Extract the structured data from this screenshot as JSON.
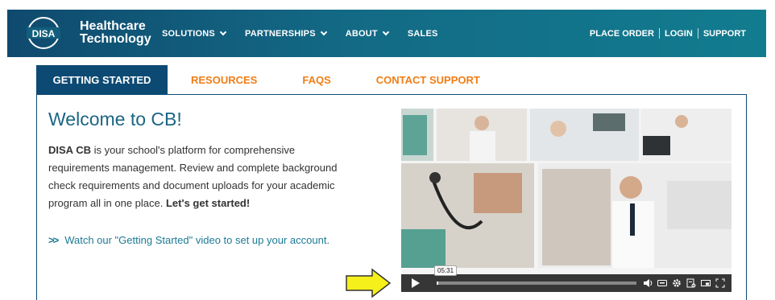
{
  "brand": {
    "logo": "DISA",
    "line1": "Healthcare",
    "line2": "Technology"
  },
  "nav": [
    {
      "label": "SOLUTIONS",
      "dropdown": true
    },
    {
      "label": "PARTNERSHIPS",
      "dropdown": true
    },
    {
      "label": "ABOUT",
      "dropdown": true
    },
    {
      "label": "SALES",
      "dropdown": false
    }
  ],
  "util_nav": [
    "PLACE ORDER",
    "LOGIN",
    "SUPPORT"
  ],
  "tabs": [
    "GETTING STARTED",
    "RESOURCES",
    "FAQS",
    "CONTACT SUPPORT"
  ],
  "content": {
    "title": "Welcome to CB!",
    "desc_brand": "DISA CB",
    "desc_body": " is your school's platform for comprehensive requirements management. Review and complete background check requirements and document uploads for your academic program all in one place. ",
    "desc_cta": "Let's get started!",
    "watch_arrows": ">>",
    "watch_text": "Watch our \"Getting Started\" video to set up your account."
  },
  "video": {
    "time": "05:31",
    "progress": 0.01
  },
  "colors": {
    "accent_orange": "#f07d16",
    "navy": "#0d4a73",
    "teal": "#1b6685",
    "pointer_yellow": "#f5ef1c"
  }
}
